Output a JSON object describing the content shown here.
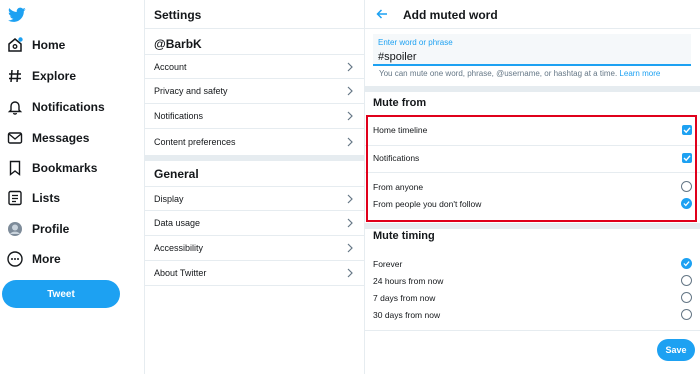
{
  "nav": {
    "items": [
      {
        "label": "Home",
        "icon": "home-icon"
      },
      {
        "label": "Explore",
        "icon": "hashtag-icon"
      },
      {
        "label": "Notifications",
        "icon": "bell-icon"
      },
      {
        "label": "Messages",
        "icon": "envelope-icon"
      },
      {
        "label": "Bookmarks",
        "icon": "bookmark-icon"
      },
      {
        "label": "Lists",
        "icon": "list-icon"
      },
      {
        "label": "Profile",
        "icon": "avatar-icon"
      },
      {
        "label": "More",
        "icon": "more-icon"
      }
    ],
    "tweet_label": "Tweet",
    "brand_color": "#1da1f2"
  },
  "settings": {
    "title": "Settings",
    "account_section": "@BarbK",
    "account_items": [
      "Account",
      "Privacy and safety",
      "Notifications",
      "Content preferences"
    ],
    "general_section": "General",
    "general_items": [
      "Display",
      "Data usage",
      "Accessibility",
      "About Twitter"
    ]
  },
  "panel": {
    "title": "Add muted word",
    "input_label": "Enter word or phrase",
    "input_value": "#spoiler",
    "hint": "You can mute one word, phrase, @username, or hashtag at a time.",
    "hint_link": "Learn more",
    "mute_from": {
      "heading": "Mute from",
      "home_timeline": "Home timeline",
      "home_timeline_checked": true,
      "notifications": "Notifications",
      "notifications_checked": true,
      "from_anyone": "From anyone",
      "from_people": "From people you don't follow",
      "selected": "from_people"
    },
    "mute_timing": {
      "heading": "Mute timing",
      "options": [
        "Forever",
        "24 hours from now",
        "7 days from now",
        "30 days from now"
      ],
      "selected": "Forever"
    },
    "save_label": "Save",
    "highlight_color": "#e0001b"
  }
}
